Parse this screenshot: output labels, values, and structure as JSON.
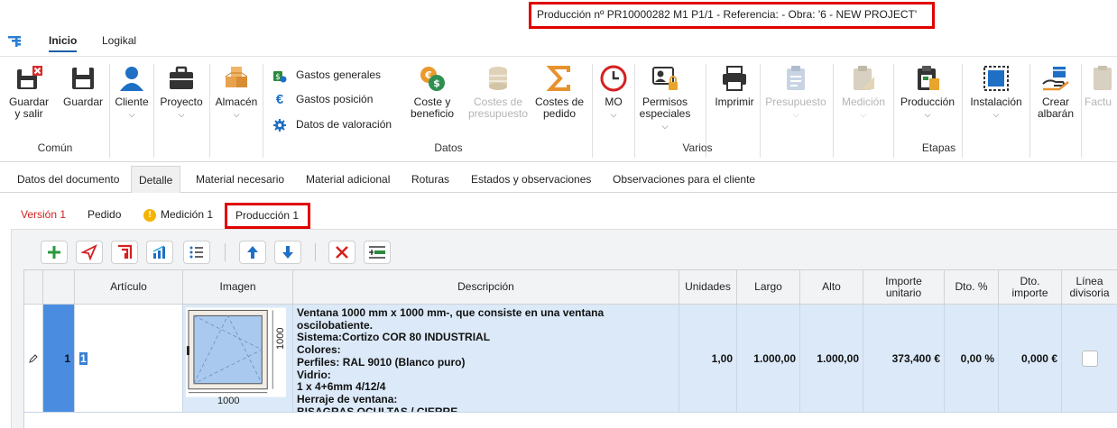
{
  "window": {
    "title": "Producción nº PR10000282 M1 P1/1 - Referencia:  - Obra: '6 - NEW PROJECT'"
  },
  "menu": {
    "tabs": [
      {
        "label": "Inicio",
        "active": true
      },
      {
        "label": "Logikal",
        "active": false
      }
    ]
  },
  "ribbon": {
    "groups": {
      "comun": "Común",
      "datos": "Datos",
      "varios": "Varios",
      "etapas": "Etapas"
    },
    "guardar_salir": "Guardar\ny salir",
    "guardar": "Guardar",
    "cliente": "Cliente",
    "proyecto": "Proyecto",
    "almacen": "Almacén",
    "gastos_generales": "Gastos generales",
    "gastos_posicion": "Gastos posición",
    "datos_valoracion": "Datos de valoración",
    "coste_beneficio": "Coste y\nbeneficio",
    "costes_presupuesto": "Costes de\npresupuesto",
    "costes_pedido": "Costes de\npedido",
    "mo": "MO",
    "permisos_especiales": "Permisos\nespeciales",
    "imprimir": "Imprimir",
    "presupuesto": "Presupuesto",
    "medicion": "Medición",
    "produccion": "Producción",
    "instalacion": "Instalación",
    "crear_albaran": "Crear\nalbarán",
    "factura": "Factu"
  },
  "doc_tabs": [
    {
      "label": "Datos del documento",
      "active": false
    },
    {
      "label": "Detalle",
      "active": true
    },
    {
      "label": "Material necesario",
      "active": false
    },
    {
      "label": "Material adicional",
      "active": false
    },
    {
      "label": "Roturas",
      "active": false
    },
    {
      "label": "Estados y observaciones",
      "active": false
    },
    {
      "label": "Observaciones para el cliente",
      "active": false
    }
  ],
  "sub_tabs": {
    "version": "Versión 1",
    "pedido": "Pedido",
    "medicion": "Medición 1",
    "produccion": "Producción 1"
  },
  "grid": {
    "headers": {
      "articulo": "Artículo",
      "imagen": "Imagen",
      "descripcion": "Descripción",
      "unidades": "Unidades",
      "largo": "Largo",
      "alto": "Alto",
      "importe_unitario": "Importe\nunitario",
      "dto_pct": "Dto. %",
      "dto_importe": "Dto.\nimporte",
      "linea_divisoria": "Línea\ndivisoria"
    },
    "row": {
      "number": "1",
      "articulo": "1",
      "image_width_label": "1000",
      "image_height_label": "1000",
      "descripcion": "Ventana 1000 mm x 1000 mm-, que consiste en una ventana oscilobatiente.\nSistema:Cortizo COR 80 INDUSTRIAL\nColores:\nPerfiles: RAL 9010 (Blanco puro)\nVidrio:\n1 x 4+6mm 4/12/4\nHerraje de ventana:\nBISAGRAS OCULTAS / CIERRE",
      "unidades": "1,00",
      "largo": "1.000,00",
      "alto": "1.000,00",
      "importe_unitario": "373,400 €",
      "dto_pct": "0,00 %",
      "dto_importe": "0,000 €",
      "linea_divisoria": false
    }
  },
  "colors": {
    "accent": "#1c5ea8",
    "highlight_red": "#e00000",
    "row_selected": "#dbe9f8",
    "row_marker": "#4a8de0"
  }
}
